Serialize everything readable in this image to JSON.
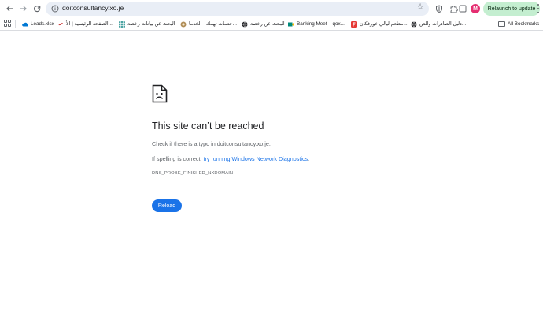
{
  "toolbar": {
    "url": "doitconsultancy.xo.je",
    "relaunch_label": "Relaunch to update",
    "avatar_letter": "M"
  },
  "bookmarks": [
    {
      "label": "Leads.xlsx",
      "icon": "onedrive-icon",
      "color": "#0078d4"
    },
    {
      "label": "الصفحة الرئيسية | الأ...",
      "icon": "bird-icon",
      "color": "#c62828"
    },
    {
      "label": "البحث عن بيانات رخصة",
      "icon": "grid-logo-icon",
      "color": "#4aa3a2"
    },
    {
      "label": "خدمات تهمك - الخدما...",
      "icon": "emblem-icon",
      "color": "#b08d57"
    },
    {
      "label": "البحث عن رخصة",
      "icon": "globe-icon",
      "color": "#202124"
    },
    {
      "label": "Banking Meet – qox...",
      "icon": "meet-icon",
      "color": "#00897b"
    },
    {
      "label": "مطعم ليالي خورفكان...",
      "icon": "restaurant-icon",
      "color": "#e53935"
    },
    {
      "label": "دليل الصادرات والص...",
      "icon": "globe-icon",
      "color": "#202124"
    }
  ],
  "all_bookmarks_label": "All Bookmarks",
  "error": {
    "title": "This site can’t be reached",
    "line1": "Check if there is a typo in doitconsultancy.xo.je.",
    "line2_prefix": "If spelling is correct, ",
    "line2_link": "try running Windows Network Diagnostics",
    "line2_suffix": ".",
    "code": "DNS_PROBE_FINISHED_NXDOMAIN",
    "reload_label": "Reload"
  },
  "colors": {
    "accent": "#1a73e8",
    "relaunch_bg": "#c4eed0",
    "omnibox_bg": "#e9eef6",
    "avatar_bg": "#e52e71"
  }
}
